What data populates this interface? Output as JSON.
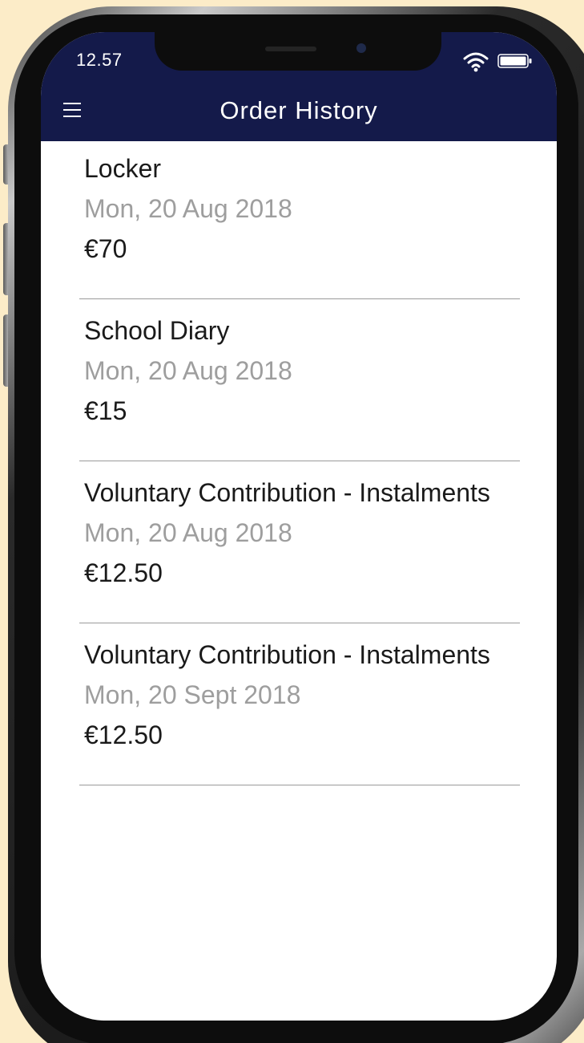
{
  "status_bar": {
    "time": "12.57",
    "wifi_icon": "wifi-icon",
    "battery_icon": "battery-icon"
  },
  "header": {
    "title": "Order History",
    "menu_icon": "hamburger-menu-icon",
    "background_color": "#141a4a",
    "text_color": "#ffffff"
  },
  "orders": [
    {
      "name": "Locker",
      "date": "Mon, 20 Aug 2018",
      "price": "€70"
    },
    {
      "name": "School Diary",
      "date": "Mon, 20 Aug 2018",
      "price": "€15"
    },
    {
      "name": "Voluntary Contribution - Instalments",
      "date": "Mon, 20 Aug 2018",
      "price": "€12.50"
    },
    {
      "name": "Voluntary Contribution - Instalments",
      "date": "Mon, 20 Sept 2018",
      "price": "€12.50"
    }
  ],
  "colors": {
    "page_background": "#fcecc8",
    "date_text": "#9e9e9e",
    "divider": "#9a9a9a"
  }
}
